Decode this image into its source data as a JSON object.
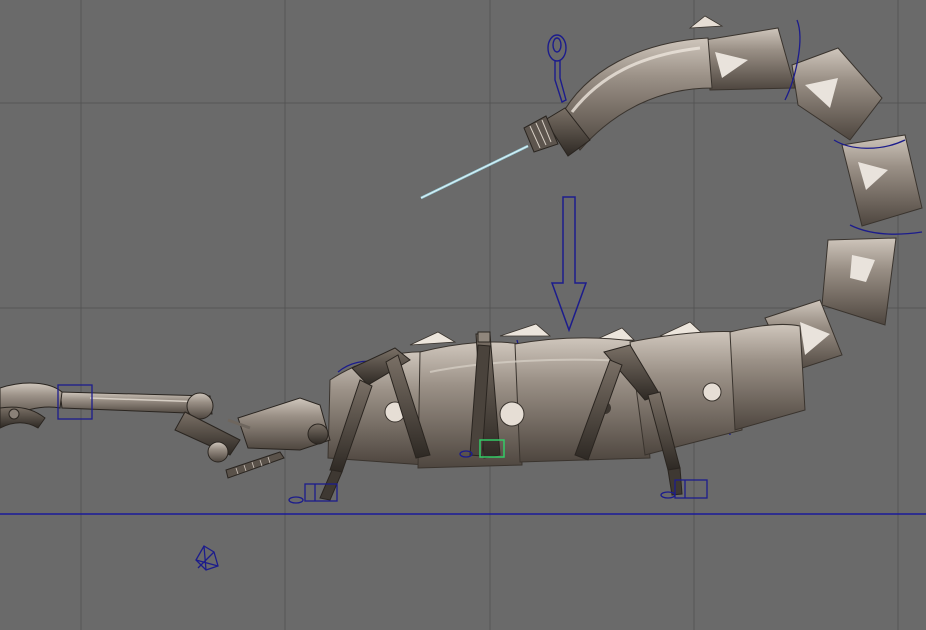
{
  "viewport": {
    "background_color": "#6a6a6a",
    "grid_color": "#555555",
    "ground_line_color": "#1a1a9a",
    "rig_control_color": "#1c1c8c",
    "selection_color": "#33cc66",
    "model_color": "#8a8178",
    "model_highlight_color": "#cfc6bc",
    "stinger_needle_color": "#9fd4e0"
  },
  "scene": {
    "object": "scorpion-model",
    "tail_segments": 6,
    "body_segments": 5,
    "visible_legs": 3
  }
}
